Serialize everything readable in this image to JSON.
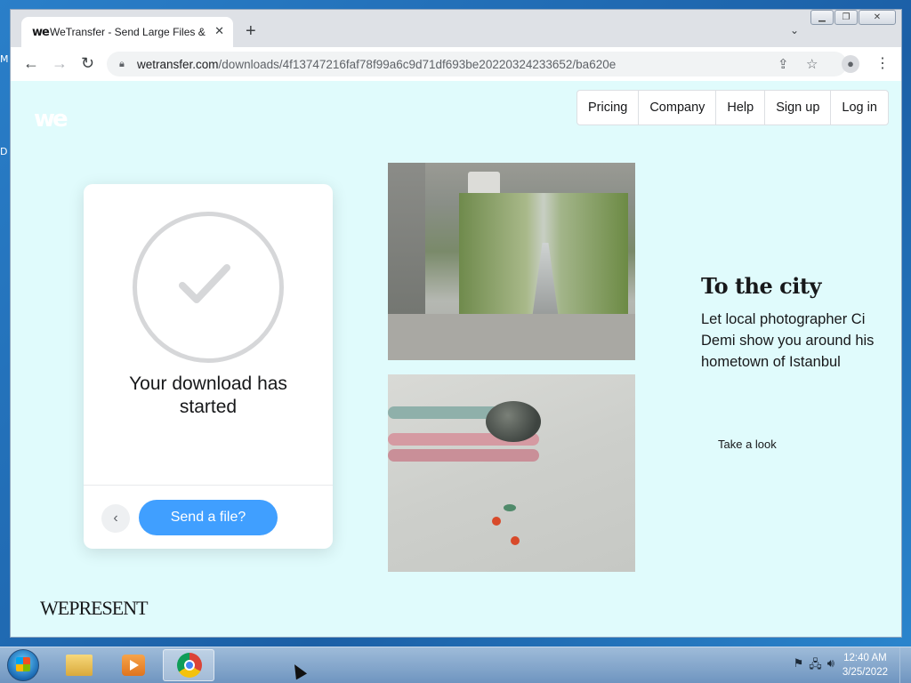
{
  "desktop": {
    "edge_text_1": "M",
    "edge_text_2": "D"
  },
  "browser": {
    "tab_title": "WeTransfer - Send Large Files &",
    "tab_favicon": "we",
    "url_host": "wetransfer.com",
    "url_path": "/downloads/4f13747216faf78f99a6c9d71df693be20220324233652/ba620e"
  },
  "page": {
    "logo": "we",
    "nav": [
      "Pricing",
      "Company",
      "Help",
      "Sign up",
      "Log in"
    ],
    "download_card": {
      "message": "Your download has started",
      "send_button": "Send a file?"
    },
    "feature": {
      "title": "To the city",
      "description": "Let local photographer Ci Demi show you around his hometown of Istanbul",
      "cta": "Take a look"
    },
    "footer_brand": "WEPRESENT"
  },
  "taskbar": {
    "time": "12:40 AM",
    "date": "3/25/2022"
  },
  "icons": [
    "back-icon",
    "forward-icon",
    "reload-icon",
    "lock-icon",
    "share-icon",
    "star-icon",
    "profile-icon",
    "menu-icon",
    "check-icon",
    "chevron-left-icon",
    "windows-start-icon",
    "explorer-icon",
    "media-player-icon",
    "chrome-icon",
    "flag-icon",
    "network-icon",
    "volume-icon"
  ]
}
